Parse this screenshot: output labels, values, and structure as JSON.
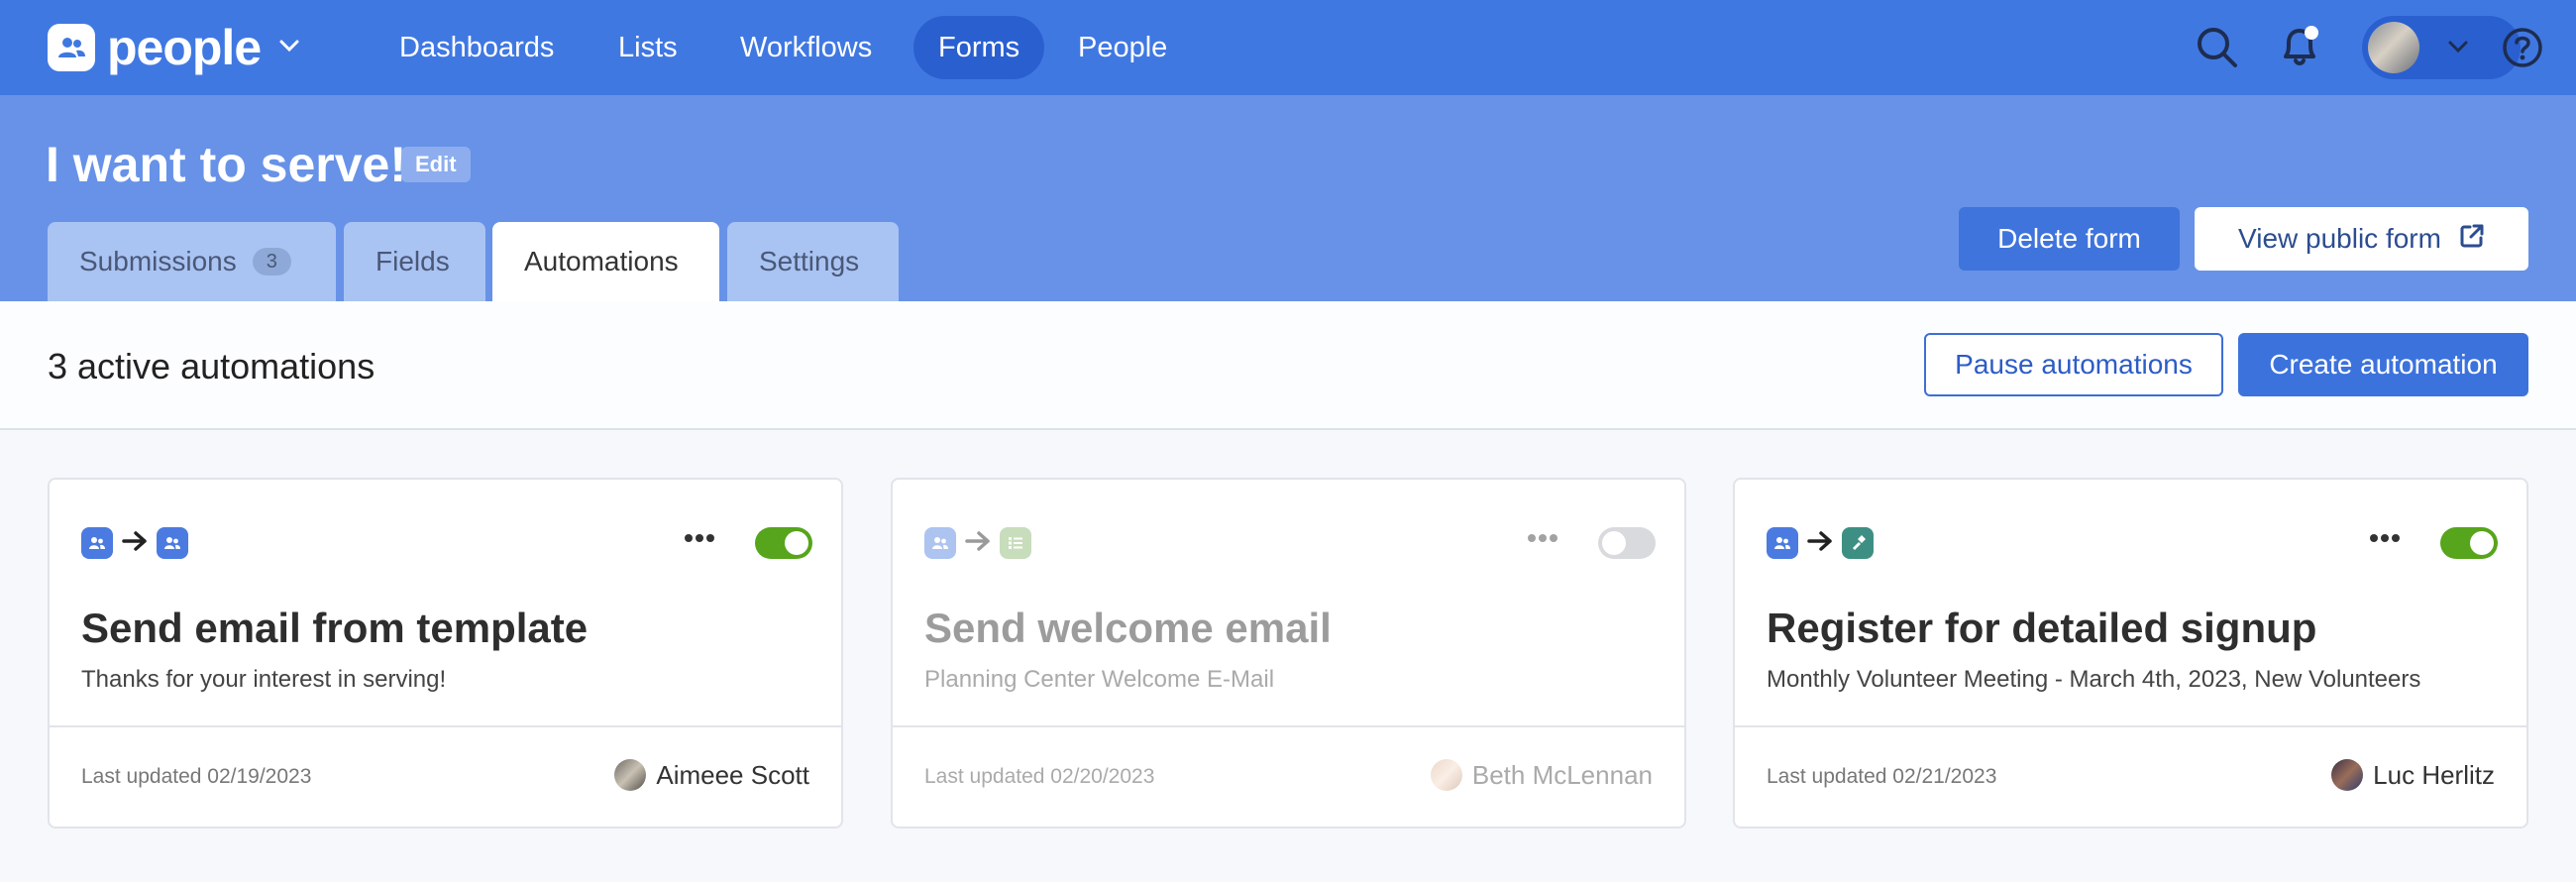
{
  "app": {
    "name": "people"
  },
  "nav": {
    "links": [
      {
        "label": "Dashboards"
      },
      {
        "label": "Lists"
      },
      {
        "label": "Workflows"
      },
      {
        "label": "Forms",
        "active": true
      },
      {
        "label": "People"
      }
    ]
  },
  "header": {
    "title": "I want to serve!",
    "edit_label": "Edit",
    "tabs": [
      {
        "label": "Submissions",
        "count": "3"
      },
      {
        "label": "Fields"
      },
      {
        "label": "Automations",
        "active": true
      },
      {
        "label": "Settings"
      }
    ],
    "delete_label": "Delete form",
    "view_label": "View public form"
  },
  "toolbar": {
    "active_count": "3 active automations",
    "pause_label": "Pause automations",
    "create_label": "Create automation"
  },
  "cards": [
    {
      "title": "Send email from template",
      "subtitle": "Thanks for your interest in serving!",
      "updated": "Last updated 02/19/2023",
      "author": "Aimeee Scott",
      "enabled": true,
      "from_icon": "people-icon",
      "to_icon": "people-icon"
    },
    {
      "title": "Send welcome email",
      "subtitle": "Planning Center Welcome E-Mail",
      "updated": "Last updated 02/20/2023",
      "author": "Beth McLennan",
      "enabled": false,
      "from_icon": "people-icon",
      "to_icon": "lists-icon"
    },
    {
      "title": "Register for detailed signup",
      "subtitle": "Monthly Volunteer Meeting - March 4th, 2023, New Volunteers",
      "updated": "Last updated 02/21/2023",
      "author": "Luc Herlitz",
      "enabled": true,
      "from_icon": "people-icon",
      "to_icon": "registrations-icon"
    }
  ],
  "colors": {
    "nav_bg": "#4078e2",
    "header_bg": "#6792e8",
    "primary": "#3c72dc",
    "toggle_on": "#56a51c",
    "people_app": "#4b7be0",
    "lists_app": "#86b66a",
    "registrations_app": "#3e8f83"
  }
}
